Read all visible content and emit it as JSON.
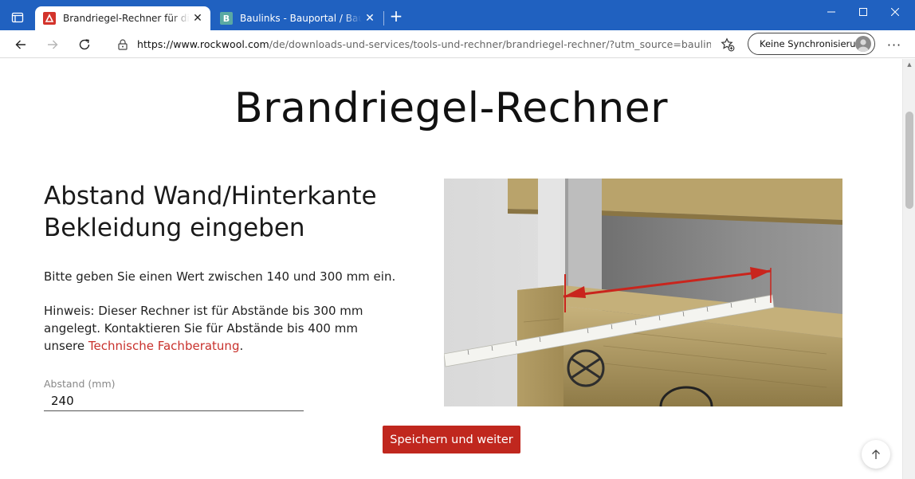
{
  "browser": {
    "tabs": [
      {
        "title": "Brandriegel-Rechner für die VHF",
        "active": true,
        "favicon": "rockwool-logo"
      },
      {
        "title": "Baulinks - Bauportal / Baumagazin",
        "active": false,
        "favicon": "baulinks-logo"
      }
    ],
    "url_host": "https://www.rockwool.com",
    "url_path": "/de/downloads-und-services/tools-und-rechner/brandriegel-rechner/?utm_source=baulinks&utm_...",
    "sync_label": "Keine Synchronisierung",
    "icons": {
      "tab_actions": "tab-actions-icon",
      "back": "back-arrow-icon",
      "forward": "forward-arrow-icon",
      "reload": "reload-icon",
      "lock": "lock-icon",
      "favorite": "add-favorite-icon",
      "more": "more-icon",
      "new_tab": "plus-icon"
    }
  },
  "page": {
    "title": "Brandriegel-Rechner",
    "step_heading": "Abstand Wand/Hinterkante Bekleidung eingeben",
    "instruction": "Bitte geben Sie einen Wert zwischen 140 und 300 mm ein.",
    "note_text": "Hinweis: Dieser Rechner ist für Abstände bis 300 mm angelegt. Kontaktieren Sie für Abstände bis 400 mm unsere ",
    "note_link": "Technische Fachberatung",
    "note_end": ".",
    "field_label": "Abstand (mm)",
    "field_value": "240",
    "submit_label": "Speichern und weiter"
  },
  "colors": {
    "accent": "#c0271e",
    "link": "#c8312c",
    "tabbar": "#2061c0"
  }
}
